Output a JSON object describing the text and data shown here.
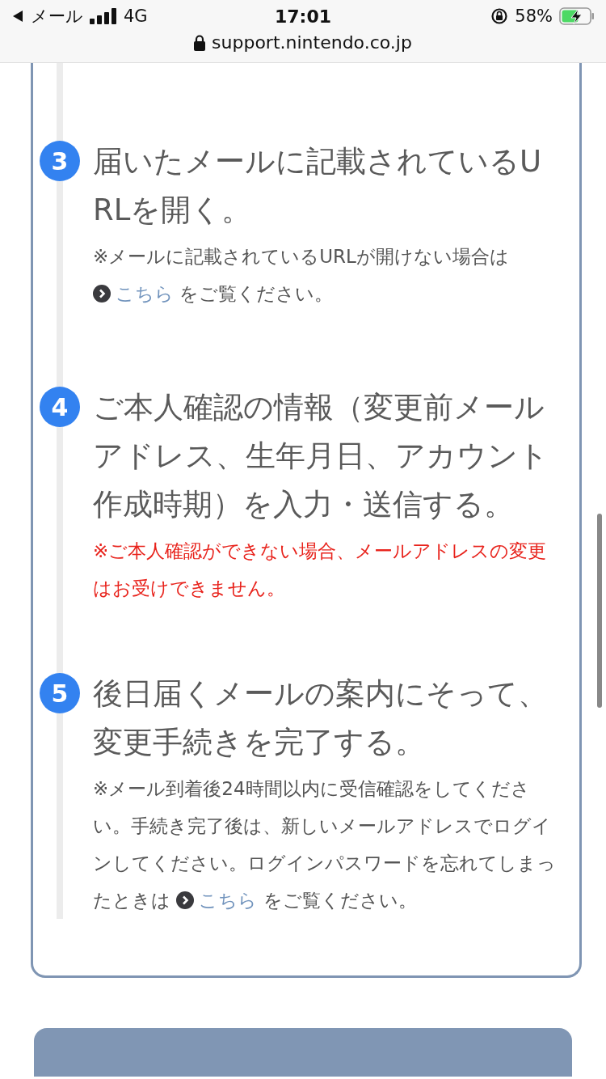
{
  "status_bar": {
    "back_label": "メール",
    "network": "4G",
    "time": "17:01",
    "battery": "58%",
    "charging": true
  },
  "address_bar": {
    "url": "support.nintendo.co.jp"
  },
  "steps": [
    {
      "number": "3",
      "title": "届いたメールに記載されているURLを開く。",
      "note": {
        "kind": "normal",
        "before": "※メールに記載されているURLが開けない場合は",
        "link": "こちら",
        "after": "をご覧ください。"
      }
    },
    {
      "number": "4",
      "title": "ご本人確認の情報（変更前メールアドレス、生年月日、アカウント作成時期）を入力・送信する。",
      "note": {
        "kind": "warning",
        "before": "※ご本人確認ができない場合、メールアドレスの変更はお受けできません。"
      }
    },
    {
      "number": "5",
      "title": "後日届くメールの案内にそって、変更手続きを完了する。",
      "note": {
        "kind": "normal",
        "before": "※メール到着後24時間以内に受信確認をしてください。手続き完了後は、新しいメールアドレスでログインしてください。ログインパスワードを忘れてしまったときは",
        "link": "こちら",
        "after": "をご覧ください。"
      }
    }
  ]
}
